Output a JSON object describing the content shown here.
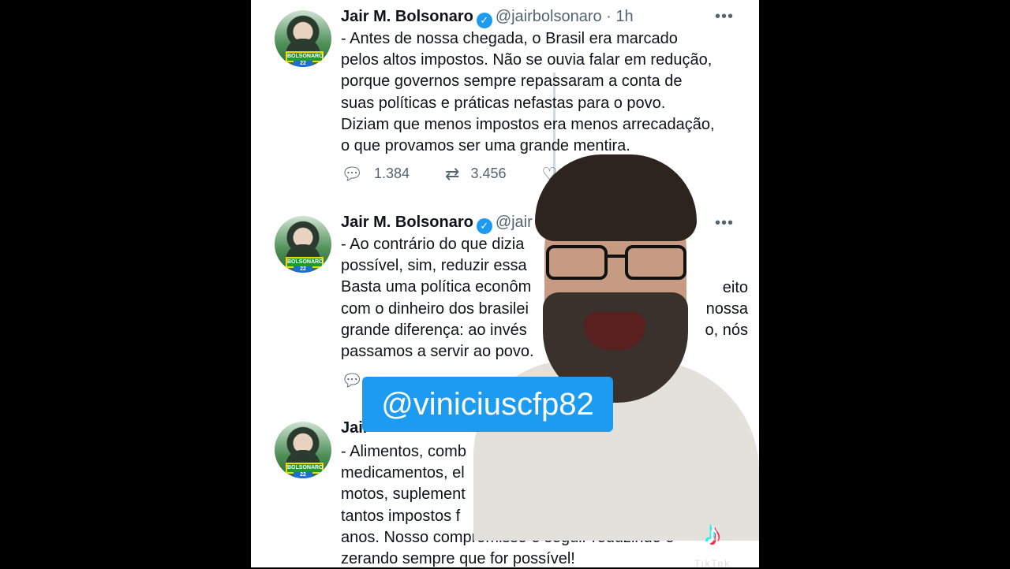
{
  "tweets": [
    {
      "name": "Jair M. Bolsonaro",
      "verified_icon": "✓",
      "handle": "@jairbolsonaro · 1h",
      "more": "•••",
      "lines": [
        "- Antes de nossa chegada, o Brasil era marcado",
        "pelos altos impostos. Não se ouvia falar em redução,",
        "porque governos sempre repassaram a conta de",
        "suas políticas e práticas nefastas para o povo.",
        "Diziam que menos impostos era menos arrecadação,",
        "o que provamos ser uma grande mentira."
      ],
      "reply_count": "1.384",
      "retweet_count": "3.456"
    },
    {
      "name": "Jair M. Bolsonaro",
      "verified_icon": "✓",
      "handle": "@jair",
      "more": "•••",
      "lines": [
        "- Ao contrário do que dizia",
        "possível, sim, reduzir essa",
        "Basta uma política econôm",
        "com o dinheiro dos brasilei",
        "grande diferença: ao invés",
        "passamos a servir ao povo."
      ],
      "lines_right": [
        "",
        "",
        "eito",
        "nossa",
        "o, nós",
        ""
      ]
    },
    {
      "name": "Jair",
      "lines": [
        "- Alimentos, comb",
        "medicamentos, el",
        "motos, suplement",
        "tantos impostos f",
        "anos. Nosso compromisso é seguir reduzindo e",
        "zerando sempre que for possível!"
      ]
    }
  ],
  "overlay": {
    "username_tag": "@viniciuscfp82",
    "tiktok_logo": "♪",
    "tiktok_word": "TikTok"
  },
  "icons": {
    "reply": "reply-icon",
    "retweet": "retweet-icon",
    "like": "heart-icon",
    "share": "share-icon"
  },
  "colors": {
    "verified": "#1d9bf0",
    "tag_bg": "#1d9bf0",
    "text": "#0f1419",
    "muted": "#536471"
  }
}
